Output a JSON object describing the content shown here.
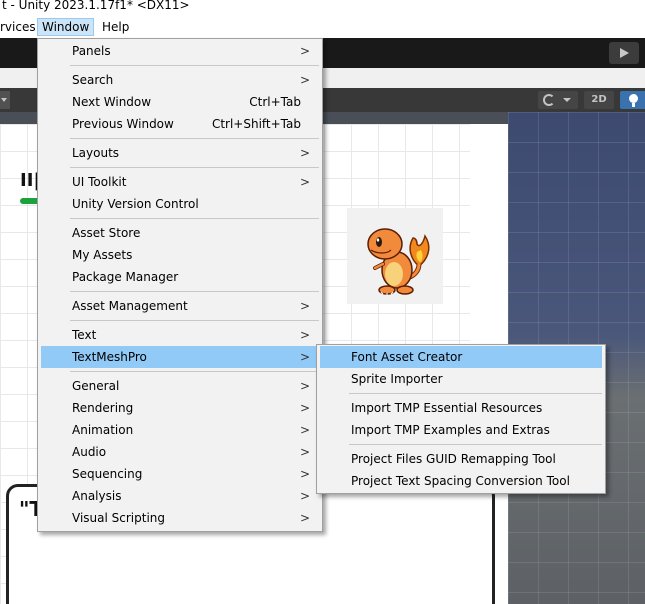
{
  "window_title": "t - Unity 2023.1.17f1* <DX11>",
  "menubar": {
    "services": "rvices",
    "window": "Window",
    "help": "Help"
  },
  "scene_toolbar": {
    "mode_2d": "2D"
  },
  "scene": {
    "hud_text": "II|",
    "dialog_text": "\"T"
  },
  "window_menu": {
    "panels": "Panels",
    "search": "Search",
    "next_window": "Next Window",
    "next_window_shortcut": "Ctrl+Tab",
    "previous_window": "Previous Window",
    "previous_window_shortcut": "Ctrl+Shift+Tab",
    "layouts": "Layouts",
    "ui_toolkit": "UI Toolkit",
    "unity_version_control": "Unity Version Control",
    "asset_store": "Asset Store",
    "my_assets": "My Assets",
    "package_manager": "Package Manager",
    "asset_management": "Asset Management",
    "text": "Text",
    "textmeshpro": "TextMeshPro",
    "general": "General",
    "rendering": "Rendering",
    "animation": "Animation",
    "audio": "Audio",
    "sequencing": "Sequencing",
    "analysis": "Analysis",
    "visual_scripting": "Visual Scripting",
    "submenu_arrow": ">"
  },
  "textmeshpro_submenu": {
    "font_asset_creator": "Font Asset Creator",
    "sprite_importer": "Sprite Importer",
    "import_essential": "Import TMP Essential Resources",
    "import_examples": "Import TMP Examples and Extras",
    "guid_remapping": "Project Files GUID Remapping Tool",
    "text_spacing": "Project Text Spacing Conversion Tool"
  },
  "colors": {
    "highlight": "#91c9f7",
    "menubar_active": "#cce4f7",
    "toolbar_dark": "#191919",
    "scene_toolbar": "#383838",
    "light_toggle_active": "#3a72b0",
    "hud_bar": "#1aa33a"
  },
  "icons": {
    "play": "play-icon",
    "draw_mode": "shading-mode-icon",
    "light": "lightbulb-icon",
    "submenu": "chevron-right-icon"
  }
}
